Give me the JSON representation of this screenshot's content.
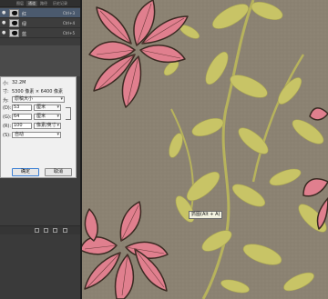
{
  "panel": {
    "tabs": [
      "图层",
      "通道",
      "路径",
      "历史记录"
    ],
    "channels": [
      {
        "name": "红",
        "shortcut": "Ctrl+3"
      },
      {
        "name": "绿",
        "shortcut": "Ctrl+4"
      },
      {
        "name": "蓝",
        "shortcut": "Ctrl+5"
      }
    ]
  },
  "dialog": {
    "size_label": "小:",
    "size_value": "32.2M",
    "dims_label": "寸:",
    "dims_value": "5300 像素 × 6400 像素",
    "fit_label": "为:",
    "fit_value": "原稿大小",
    "width_label": "(D):",
    "width_value": "53",
    "width_unit": "厘米",
    "height_label": "(G):",
    "height_value": "64",
    "height_unit": "厘米",
    "res_label": "(R):",
    "res_value": "100",
    "res_unit": "像素/英寸",
    "resample_label": "(S):",
    "resample_value": "自动",
    "ok_label": "确定",
    "cancel_label": "取消"
  },
  "canvas": {
    "tooltip": "抓图(Alt + A)",
    "colors": {
      "background": "#8b8272",
      "leaf_pink": "#e07f8e",
      "leaf_green": "#c8c466",
      "outline": "#3a2a22"
    }
  }
}
